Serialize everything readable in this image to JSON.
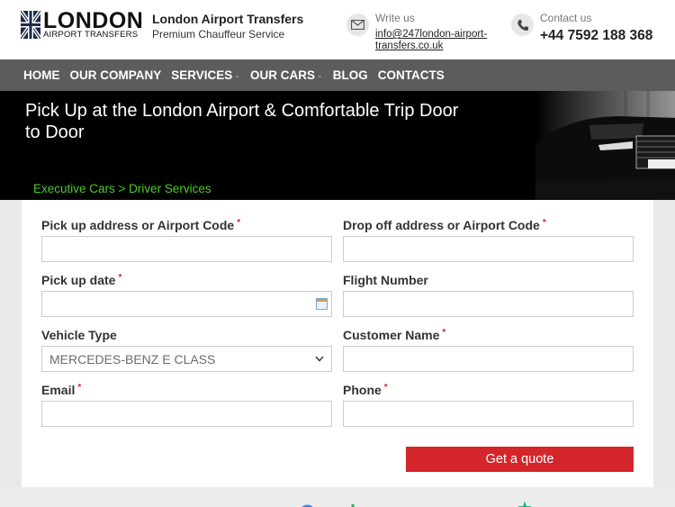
{
  "header": {
    "logo_word": "LONDON",
    "logo_sub": "AIRPORT TRANSFERS",
    "brand_name": "London Airport Transfers",
    "brand_tagline": "Premium Chauffeur Service",
    "write_label": "Write us",
    "email": "info@247london-airport-transfers.co.uk",
    "contact_label": "Contact us",
    "phone": "+44 7592 188 368"
  },
  "nav": {
    "items": [
      {
        "label": "HOME",
        "has_dropdown": false
      },
      {
        "label": "OUR COMPANY",
        "has_dropdown": false
      },
      {
        "label": "SERVICES",
        "has_dropdown": true
      },
      {
        "label": "OUR CARS",
        "has_dropdown": true
      },
      {
        "label": "BLOG",
        "has_dropdown": false
      },
      {
        "label": "CONTACTS",
        "has_dropdown": false
      }
    ],
    "caret": "⌄"
  },
  "hero": {
    "title": "Pick Up at the London Airport & Comfortable Trip Door to Door",
    "breadcrumb": "Executive Cars > Driver Services"
  },
  "form": {
    "pickup_label": "Pick up address or Airport Code",
    "dropoff_label": "Drop off address or Airport Code",
    "pickup_date_label": "Pick up date",
    "flight_label": "Flight Number",
    "vehicle_label": "Vehicle Type",
    "vehicle_value": "MERCEDES-BENZ E CLASS",
    "customer_label": "Customer Name",
    "email_label": "Email",
    "phone_label": "Phone",
    "required_mark": "*",
    "submit_label": "Get a quote"
  },
  "colors": {
    "nav_bg": "#5c5c5c",
    "breadcrumb": "#4ccc2a",
    "button": "#d4262a",
    "required": "#dd2222"
  }
}
